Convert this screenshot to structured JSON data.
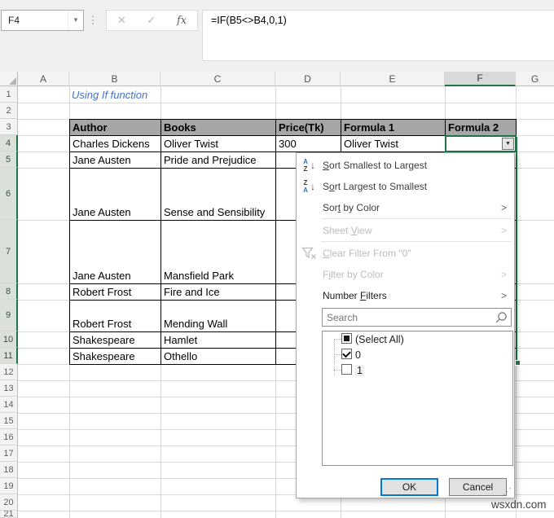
{
  "formula_bar": {
    "name_box_value": "F4",
    "formula": "=IF(B5<>B4,0,1)"
  },
  "icons": {
    "name_box_dropdown": "▼",
    "more_dots": "⋮",
    "formula_cancel": "✕",
    "formula_enter": "✓",
    "formula_fx": "fx",
    "filter_button_arrow": "▼",
    "submenu_chevron": ">",
    "sort_arrow": "↓",
    "letter_a": "A",
    "letter_z": "Z",
    "resize_grip": "⋰"
  },
  "column_headers": [
    "A",
    "B",
    "C",
    "D",
    "E",
    "F",
    "G"
  ],
  "row_headers": [
    "1",
    "2",
    "3",
    "4",
    "5",
    "6",
    "7",
    "8",
    "9",
    "10",
    "11",
    "12",
    "13",
    "14",
    "15",
    "16",
    "17",
    "18",
    "19",
    "20",
    "21"
  ],
  "sheet": {
    "note": "Using If function"
  },
  "table": {
    "headers": [
      "Author",
      "Books",
      "Price(Tk)",
      "Formula 1",
      "Formula 2"
    ],
    "rows": [
      {
        "author": "Charles Dickens",
        "book": "Oliver Twist",
        "price": "300",
        "formula1": "Oliver Twist"
      },
      {
        "author": "Jane Austen",
        "book": "Pride and Prejudice"
      },
      {
        "author": "Jane Austen",
        "book": "Sense and Sensibility"
      },
      {
        "author": "Jane Austen",
        "book": "Mansfield Park"
      },
      {
        "author": "Robert Frost",
        "book": "Fire and Ice"
      },
      {
        "author": "Robert Frost",
        "book": "Mending Wall"
      },
      {
        "author": "Shakespeare",
        "book": "Hamlet"
      },
      {
        "author": "Shakespeare",
        "book": "Othello"
      }
    ]
  },
  "filter_menu": {
    "sort_smallest": {
      "pre": "",
      "u": "S",
      "rest": "ort Smallest to Largest"
    },
    "sort_largest": {
      "pre": "S",
      "u": "o",
      "rest": "rt Largest to Smallest"
    },
    "sort_by_color": {
      "pre": "Sor",
      "u": "t",
      "rest": " by Color"
    },
    "sheet_view": {
      "pre": "Sheet ",
      "u": "V",
      "rest": "iew"
    },
    "clear_filter": {
      "pre": "",
      "u": "C",
      "rest": "lear Filter From \"0\""
    },
    "filter_by_color": {
      "pre": "F",
      "u": "i",
      "rest": "lter by Color"
    },
    "number_filters": {
      "pre": "Number ",
      "u": "F",
      "rest": "ilters"
    },
    "search_placeholder": "Search",
    "list_items": [
      {
        "label": "(Select All)",
        "state": "indeterminate"
      },
      {
        "label": "0",
        "state": "checked"
      },
      {
        "label": "1",
        "state": "unchecked"
      }
    ],
    "ok_label": "OK",
    "cancel_label": "Cancel"
  },
  "watermark": "wsxdn.com",
  "colors": {
    "accent_green": "#217346",
    "table_header_fill": "#a6a6a6",
    "note_blue": "#4472c4",
    "ok_border_blue": "#0078d7"
  }
}
